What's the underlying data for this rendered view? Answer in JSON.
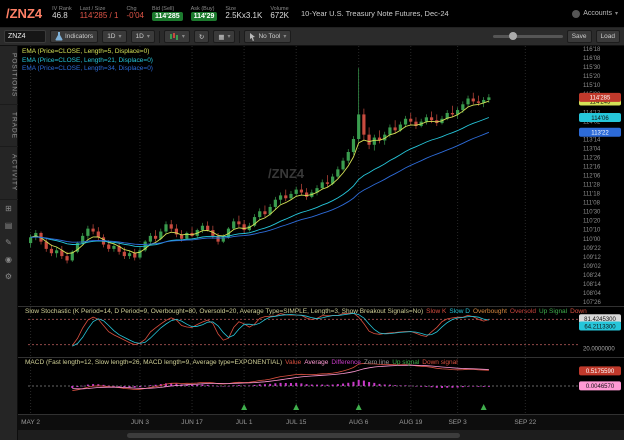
{
  "header": {
    "symbol": "/ZNZ4",
    "iv_rank_label": "IV Rank",
    "iv_rank": "46.8",
    "last_label": "Last / Size",
    "last": "114'285 / 1",
    "chg_label": "Chg",
    "chg": "-0'04",
    "bid_label": "Bid (Sell)",
    "bid": "114'285",
    "ask_label": "Ask (Buy)",
    "ask": "114'29",
    "size_label": "Size",
    "size": "2.5Kx3.1K",
    "volume_label": "Volume",
    "volume": "672K",
    "description": "10-Year U.S. Treasury Note Futures, Dec-24",
    "accounts_label": "Accounts"
  },
  "toolbar": {
    "symbol_input": "ZNZ4",
    "indicators_label": "Indicators",
    "timeframe": "1D",
    "aggregation": "1D",
    "no_tool_label": "No Tool",
    "save_label": "Save",
    "load_label": "Load"
  },
  "sidebar": {
    "tabs": [
      "POSITIONS",
      "TRADE",
      "ACTIVITY"
    ]
  },
  "chart": {
    "watermark": "/ZNZ4",
    "colors": {
      "up": "#3a9d4e",
      "down": "#c84b3f",
      "last_bubble": "#c0392b"
    },
    "axis": {
      "top": 116.5625,
      "step": 0.3125,
      "count": 29
    },
    "legend": [
      {
        "text": "EMA (Price=CLOSE, Length=5, Displace=0)",
        "color": "#d4e157"
      },
      {
        "text": "EMA (Price=CLOSE, Length=21, Displace=0)",
        "color": "#26c6da"
      },
      {
        "text": "EMA (Price=CLOSE, Length=34, Displace=0)",
        "color": "#2d6bd8"
      }
    ]
  },
  "stoch": {
    "title": "Slow Stochastic (K Period=14, D Period=9, Overbought=80, Oversold=20, Average Type=SIMPLE, Length=3, Show Breakout Signals=No)",
    "legend": [
      {
        "text": "Slow K",
        "color": "#d94f3f"
      },
      {
        "text": "Slow D",
        "color": "#26c6da"
      },
      {
        "text": "Overbought",
        "color": "#d98a3f"
      },
      {
        "text": "Oversold",
        "color": "#c8443c"
      },
      {
        "text": "Up Signal",
        "color": "#3fae4c"
      },
      {
        "text": "Down",
        "color": "#d94f3f"
      }
    ],
    "overbought": 80,
    "oversold": 20,
    "k_value": "81.4245300",
    "d_value": "64.2113300",
    "oversold_value": "20.0000000"
  },
  "macd": {
    "title": "MACD (Fast length=12, Slow length=26, MACD length=9, Average type=EXPONENTIAL)",
    "legend": [
      {
        "text": "Value",
        "color": "#d94f3f"
      },
      {
        "text": "Average",
        "color": "#ff9ad5"
      },
      {
        "text": "Difference",
        "color": "#c93bc9"
      },
      {
        "text": "Zero line",
        "color": "#9a9a9a"
      },
      {
        "text": "Up signal",
        "color": "#3fae4c"
      },
      {
        "text": "Down signal",
        "color": "#d94f3f"
      }
    ],
    "value": "0.5175590",
    "average": "0.0046570"
  },
  "chart_data": {
    "type": "candlestick",
    "symbol": "/ZNZ4",
    "title": "10-Year U.S. Treasury Note Futures, Dec-24, Daily",
    "ylim": [
      107.8125,
      116.5625
    ],
    "emas": [
      5,
      21,
      34
    ],
    "x_labels": [
      {
        "label": "MAY 2",
        "i": 0
      },
      {
        "label": "JUN 3",
        "i": 21
      },
      {
        "label": "JUN 17",
        "i": 31
      },
      {
        "label": "JUL 1",
        "i": 41
      },
      {
        "label": "JUL 15",
        "i": 51
      },
      {
        "label": "AUG 6",
        "i": 63
      },
      {
        "label": "AUG 19",
        "i": 73
      },
      {
        "label": "SEP 3",
        "i": 82
      },
      {
        "label": "SEP 22",
        "i": 95
      }
    ],
    "signals_up": [
      41,
      51,
      63,
      87
    ],
    "candles": [
      [
        109.85,
        110.15,
        109.7,
        110.05
      ],
      [
        110.05,
        110.3,
        109.95,
        110.2
      ],
      [
        110.2,
        110.25,
        109.8,
        109.9
      ],
      [
        109.9,
        110.0,
        109.55,
        109.65
      ],
      [
        109.65,
        109.8,
        109.4,
        109.5
      ],
      [
        109.5,
        109.7,
        109.35,
        109.6
      ],
      [
        109.6,
        109.75,
        109.3,
        109.4
      ],
      [
        109.4,
        109.55,
        109.15,
        109.25
      ],
      [
        109.25,
        109.6,
        109.2,
        109.55
      ],
      [
        109.55,
        109.9,
        109.5,
        109.85
      ],
      [
        109.85,
        110.2,
        109.8,
        110.1
      ],
      [
        110.1,
        110.45,
        110.0,
        110.35
      ],
      [
        110.35,
        110.5,
        110.15,
        110.25
      ],
      [
        110.25,
        110.4,
        109.95,
        110.05
      ],
      [
        110.05,
        110.15,
        109.7,
        109.8
      ],
      [
        109.8,
        109.95,
        109.55,
        109.65
      ],
      [
        109.65,
        109.85,
        109.55,
        109.75
      ],
      [
        109.75,
        109.9,
        109.45,
        109.55
      ],
      [
        109.55,
        109.7,
        109.3,
        109.4
      ],
      [
        109.4,
        109.6,
        109.3,
        109.5
      ],
      [
        109.5,
        109.65,
        109.25,
        109.35
      ],
      [
        109.35,
        109.7,
        109.3,
        109.6
      ],
      [
        109.6,
        109.95,
        109.55,
        109.9
      ],
      [
        109.9,
        110.2,
        109.8,
        110.1
      ],
      [
        110.1,
        110.3,
        109.9,
        110.0
      ],
      [
        110.0,
        110.35,
        109.95,
        110.25
      ],
      [
        110.25,
        110.6,
        110.15,
        110.5
      ],
      [
        110.5,
        110.65,
        110.25,
        110.35
      ],
      [
        110.35,
        110.5,
        110.05,
        110.15
      ],
      [
        110.15,
        110.3,
        109.9,
        110.0
      ],
      [
        110.0,
        110.25,
        109.95,
        110.2
      ],
      [
        110.2,
        110.4,
        110.05,
        110.1
      ],
      [
        110.1,
        110.35,
        110.0,
        110.3
      ],
      [
        110.3,
        110.55,
        110.2,
        110.45
      ],
      [
        110.45,
        110.6,
        110.25,
        110.3
      ],
      [
        110.3,
        110.45,
        110.0,
        110.1
      ],
      [
        110.1,
        110.2,
        109.8,
        109.9
      ],
      [
        109.9,
        110.15,
        109.85,
        110.05
      ],
      [
        110.05,
        110.4,
        110.0,
        110.35
      ],
      [
        110.35,
        110.7,
        110.3,
        110.6
      ],
      [
        110.6,
        110.8,
        110.4,
        110.5
      ],
      [
        110.5,
        110.65,
        110.2,
        110.3
      ],
      [
        110.3,
        110.55,
        110.25,
        110.45
      ],
      [
        110.45,
        110.85,
        110.4,
        110.75
      ],
      [
        110.75,
        111.05,
        110.65,
        110.95
      ],
      [
        110.95,
        111.15,
        110.75,
        110.85
      ],
      [
        110.85,
        111.2,
        110.8,
        111.1
      ],
      [
        111.1,
        111.45,
        111.0,
        111.35
      ],
      [
        111.35,
        111.6,
        111.2,
        111.5
      ],
      [
        111.5,
        111.7,
        111.3,
        111.4
      ],
      [
        111.4,
        111.65,
        111.35,
        111.55
      ],
      [
        111.55,
        111.8,
        111.45,
        111.7
      ],
      [
        111.7,
        111.9,
        111.5,
        111.6
      ],
      [
        111.6,
        111.75,
        111.35,
        111.45
      ],
      [
        111.45,
        111.7,
        111.4,
        111.6
      ],
      [
        111.6,
        111.85,
        111.5,
        111.75
      ],
      [
        111.75,
        112.05,
        111.7,
        111.95
      ],
      [
        111.95,
        112.2,
        111.8,
        111.9
      ],
      [
        111.9,
        112.25,
        111.85,
        112.15
      ],
      [
        112.15,
        112.5,
        112.1,
        112.4
      ],
      [
        112.4,
        112.8,
        112.35,
        112.7
      ],
      [
        112.7,
        113.1,
        112.6,
        113.0
      ],
      [
        113.0,
        113.55,
        112.9,
        113.45
      ],
      [
        113.45,
        115.9,
        113.35,
        114.3
      ],
      [
        114.3,
        114.5,
        113.4,
        113.6
      ],
      [
        113.6,
        113.85,
        113.1,
        113.25
      ],
      [
        113.25,
        113.6,
        113.05,
        113.5
      ],
      [
        113.5,
        113.75,
        113.3,
        113.4
      ],
      [
        113.4,
        113.7,
        113.25,
        113.6
      ],
      [
        113.6,
        113.95,
        113.5,
        113.85
      ],
      [
        113.85,
        114.1,
        113.65,
        113.75
      ],
      [
        113.75,
        114.05,
        113.7,
        113.95
      ],
      [
        113.95,
        114.25,
        113.85,
        114.15
      ],
      [
        114.15,
        114.35,
        113.95,
        114.05
      ],
      [
        114.05,
        114.2,
        113.8,
        113.9
      ],
      [
        113.9,
        114.15,
        113.85,
        114.05
      ],
      [
        114.05,
        114.3,
        113.95,
        114.2
      ],
      [
        114.2,
        114.4,
        114.0,
        114.1
      ],
      [
        114.1,
        114.3,
        113.9,
        114.0
      ],
      [
        114.0,
        114.25,
        113.95,
        114.15
      ],
      [
        114.15,
        114.45,
        114.1,
        114.35
      ],
      [
        114.35,
        114.6,
        114.2,
        114.3
      ],
      [
        114.3,
        114.55,
        114.15,
        114.45
      ],
      [
        114.45,
        114.75,
        114.35,
        114.65
      ],
      [
        114.65,
        114.95,
        114.55,
        114.85
      ],
      [
        114.85,
        115.05,
        114.65,
        114.75
      ],
      [
        114.75,
        114.95,
        114.6,
        114.7
      ],
      [
        114.7,
        114.9,
        114.55,
        114.8
      ],
      [
        114.8,
        115.0,
        114.7,
        114.89
      ]
    ]
  }
}
